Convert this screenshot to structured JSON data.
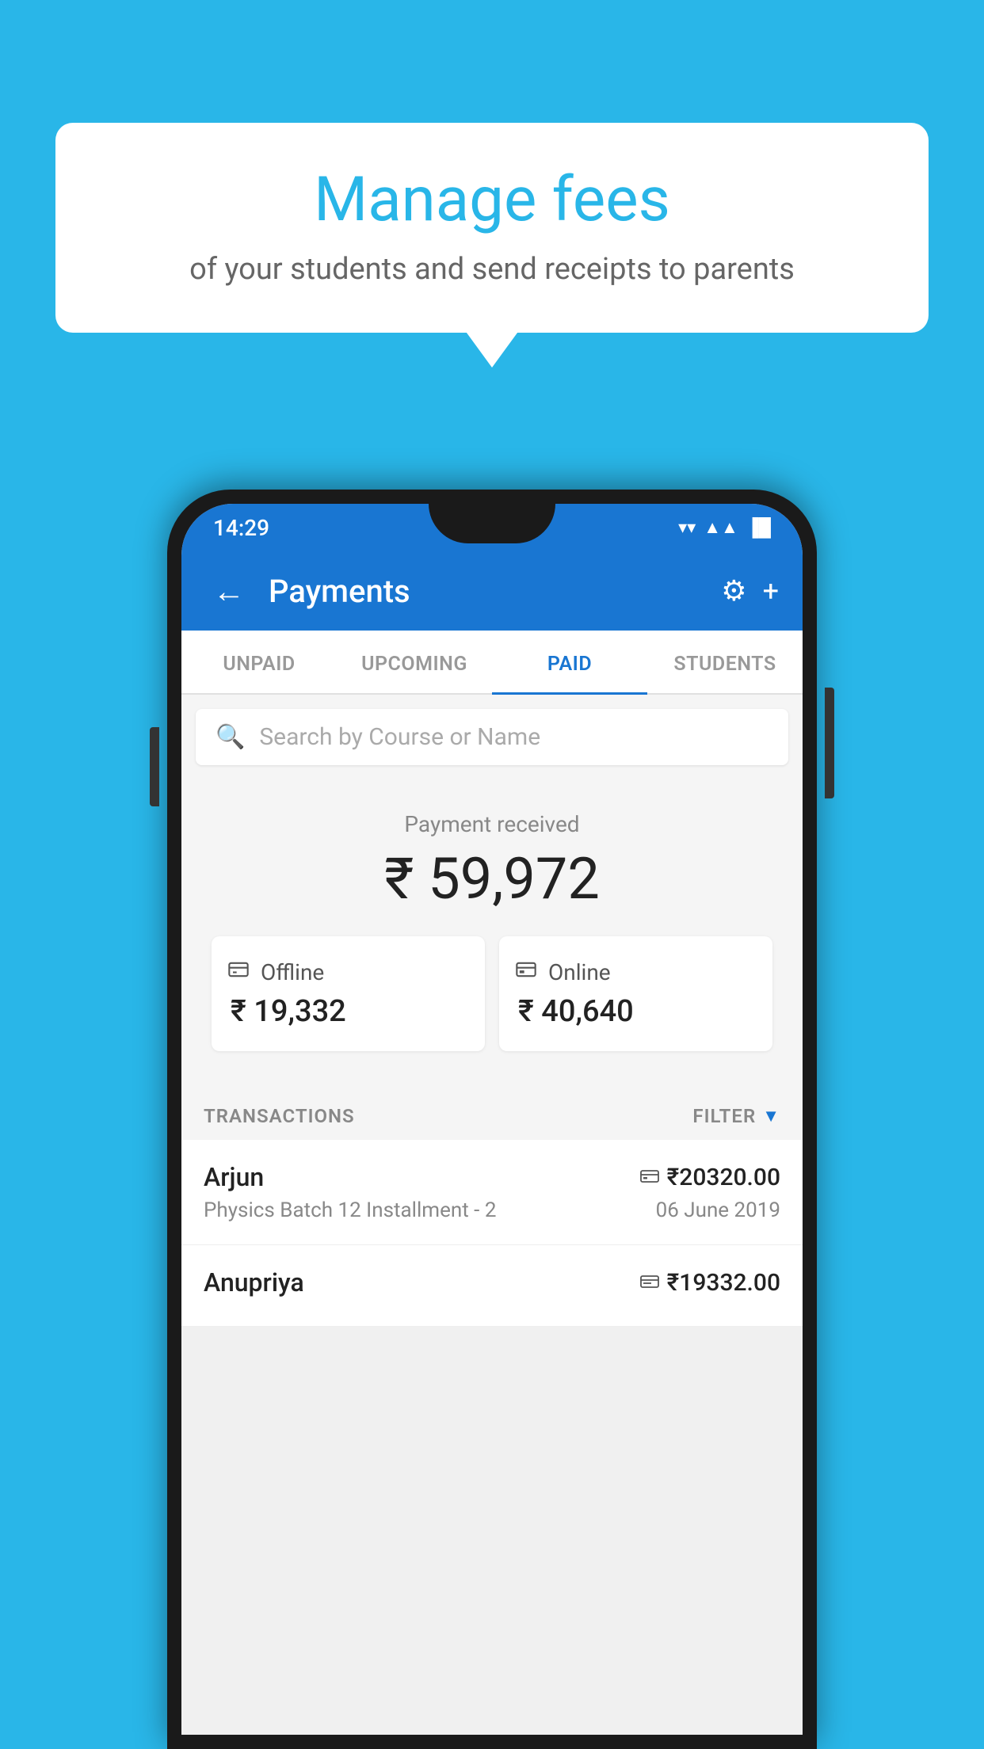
{
  "background_color": "#29b6e8",
  "bubble": {
    "title": "Manage fees",
    "subtitle": "of your students and send receipts to parents"
  },
  "status_bar": {
    "time": "14:29",
    "wifi": "▼",
    "signal": "▲",
    "battery": "▌"
  },
  "app_bar": {
    "title": "Payments",
    "back_icon": "←",
    "settings_icon": "⚙",
    "add_icon": "+"
  },
  "tabs": [
    {
      "label": "UNPAID",
      "active": false
    },
    {
      "label": "UPCOMING",
      "active": false
    },
    {
      "label": "PAID",
      "active": true
    },
    {
      "label": "STUDENTS",
      "active": false
    }
  ],
  "search": {
    "placeholder": "Search by Course or Name"
  },
  "payment_received": {
    "label": "Payment received",
    "amount": "₹ 59,972",
    "offline": {
      "icon": "💳",
      "label": "Offline",
      "amount": "₹ 19,332"
    },
    "online": {
      "icon": "💳",
      "label": "Online",
      "amount": "₹ 40,640"
    }
  },
  "transactions": {
    "header_label": "TRANSACTIONS",
    "filter_label": "FILTER",
    "items": [
      {
        "name": "Arjun",
        "amount": "₹20320.00",
        "detail": "Physics Batch 12 Installment - 2",
        "date": "06 June 2019",
        "payment_type": "online"
      },
      {
        "name": "Anupriya",
        "amount": "₹19332.00",
        "detail": "",
        "date": "",
        "payment_type": "offline"
      }
    ]
  }
}
